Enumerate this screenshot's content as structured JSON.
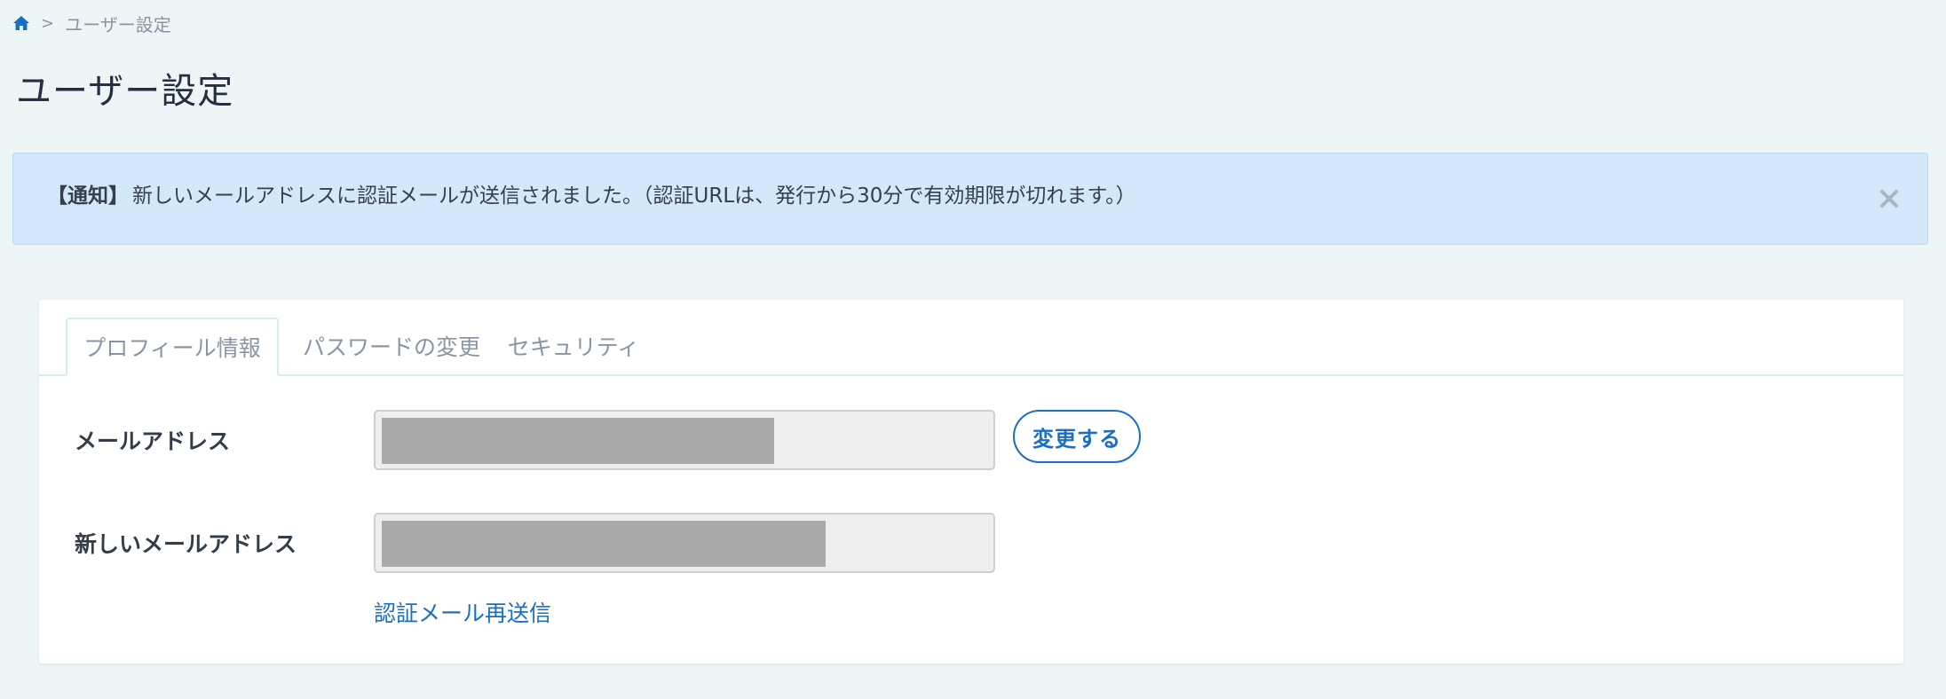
{
  "breadcrumb": {
    "separator": ">",
    "current": "ユーザー設定"
  },
  "page": {
    "title": "ユーザー設定"
  },
  "alert": {
    "label": "【通知】",
    "message": "新しいメールアドレスに認証メールが送信されました。（認証URLは、発行から30分で有効期限が切れます。）",
    "close_symbol": "×"
  },
  "tabs": [
    {
      "label": "プロフィール情報",
      "active": true
    },
    {
      "label": "パスワードの変更",
      "active": false
    },
    {
      "label": "セキュリティ",
      "active": false
    }
  ],
  "form": {
    "email_label": "メールアドレス",
    "new_email_label": "新しいメールアドレス",
    "change_button": "変更する",
    "resend_link": "認証メール再送信"
  },
  "icons": {
    "home": "home-icon",
    "close": "close-icon"
  },
  "colors": {
    "accent": "#1a6fc4",
    "alert_bg": "#d4e8fb",
    "page_bg": "#edf5f7",
    "redacted": "#aaaaaa"
  }
}
